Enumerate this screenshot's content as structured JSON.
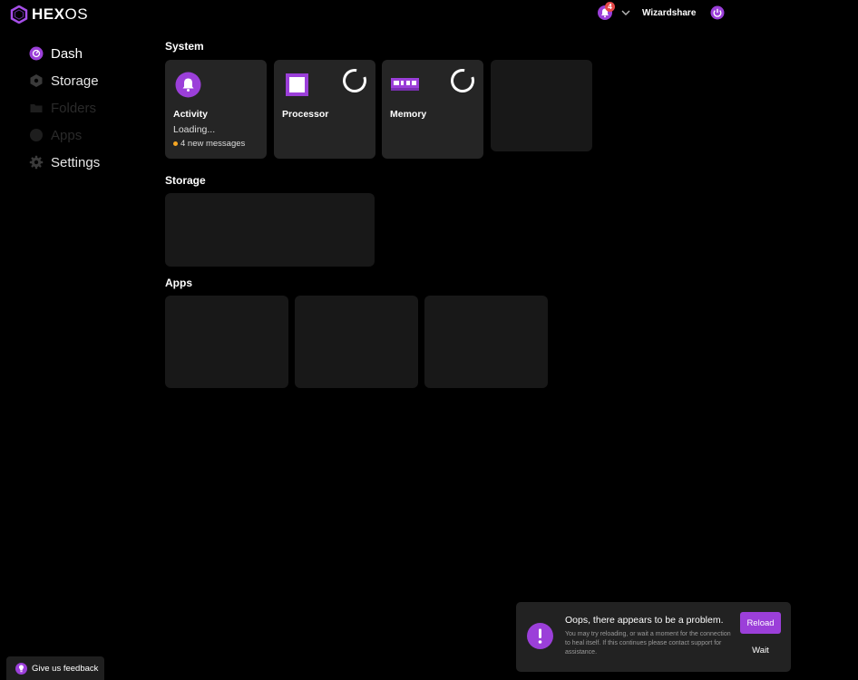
{
  "brand": {
    "logo_main": "HEX",
    "logo_os": "OS"
  },
  "header": {
    "notification_count": "4",
    "username": "Wizardshare"
  },
  "nav": {
    "items": [
      {
        "label": "Dash",
        "icon": "dash-icon"
      },
      {
        "label": "Storage",
        "icon": "hexagon-icon"
      },
      {
        "label": "Folders",
        "icon": "folder-icon"
      },
      {
        "label": "Apps",
        "icon": "apps-icon"
      },
      {
        "label": "Settings",
        "icon": "gear-icon"
      }
    ]
  },
  "sections": {
    "system": "System",
    "storage": "Storage",
    "apps": "Apps"
  },
  "cards": {
    "activity": {
      "label": "Activity",
      "status": "Loading...",
      "messages": "4 new messages"
    },
    "processor": {
      "label": "Processor"
    },
    "memory": {
      "label": "Memory"
    }
  },
  "feedback": {
    "label": "Give us feedback"
  },
  "toast": {
    "title": "Oops, there appears to be a problem.",
    "body": "You may try reloading, or wait a moment for the connection to heal itself. If this continues please contact support for assistance.",
    "reload": "Reload",
    "wait": "Wait"
  },
  "colors": {
    "accent": "#9b3fd9",
    "card": "#252525",
    "card_empty": "#181818",
    "badge": "#e54848",
    "dot": "#f5a623"
  }
}
